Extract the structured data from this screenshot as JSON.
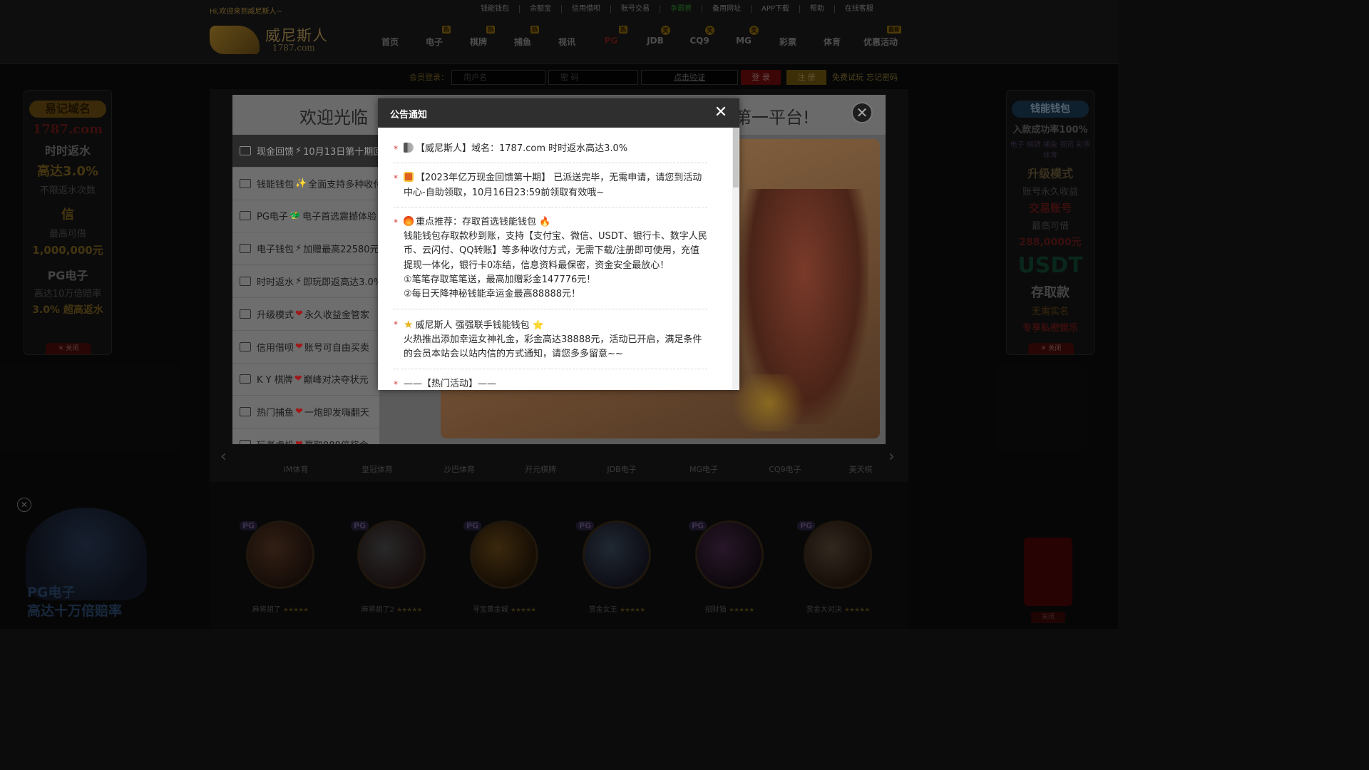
{
  "header": {
    "welcome": "Hi,欢迎来到威尼斯人~",
    "top_links": [
      "钱能钱包",
      "余额宝",
      "信用借呗",
      "账号交易",
      "争霸赛",
      "备用网址",
      "APP下载",
      "帮助",
      "在线客服"
    ],
    "top_links_highlight_index": 4,
    "logo_name": "威尼斯人",
    "logo_domain": "1787.com",
    "nav": [
      {
        "label": "首页",
        "tag": ""
      },
      {
        "label": "电子",
        "tag": "热"
      },
      {
        "label": "棋牌",
        "tag": "热"
      },
      {
        "label": "捕鱼",
        "tag": "热"
      },
      {
        "label": "视讯",
        "tag": ""
      },
      {
        "label": "PG",
        "tag": "热"
      },
      {
        "label": "JDB",
        "tag": "奖"
      },
      {
        "label": "CQ9",
        "tag": "奖"
      },
      {
        "label": "MG",
        "tag": "奖"
      },
      {
        "label": "彩票",
        "tag": ""
      },
      {
        "label": "体育",
        "tag": ""
      },
      {
        "label": "优惠活动",
        "tag": "最新"
      }
    ]
  },
  "login": {
    "label": "会员登录：",
    "username_placeholder": "用户名",
    "password_placeholder": "密 码",
    "verify_label": "点击验证",
    "login_button": "登 录",
    "register_button": "注 册",
    "free_trial": "免费试玩",
    "forgot_password": "忘记密码"
  },
  "left_ad": {
    "pill": "易记域名",
    "domain": "1787.com",
    "line1": "时时返水",
    "line2": "高达3.0%",
    "line3": "不限返水次数",
    "line4": "信",
    "line5": "最高可借",
    "line6": "1,000,000元",
    "line7": "PG电子",
    "line8": "高达10万倍赔率",
    "line9": "3.0% 超高返水",
    "close": "✕ 关闭"
  },
  "right_ad": {
    "pill": "钱能钱包",
    "line1": "入款成功率100%",
    "tags": [
      "电子",
      "棋牌",
      "捕鱼",
      "视讯",
      "彩票",
      "体育"
    ],
    "line2": "升级模式",
    "line3": "账号永久收益",
    "line4": "交易账号",
    "line5": "最高可借",
    "line6": "288,0000元",
    "line7": "USDT",
    "line8": "存取款",
    "line9": "无需实名",
    "line10": "专享私密娱乐",
    "close": "✕ 关闭"
  },
  "providers": [
    "IM体育",
    "皇冠体育",
    "沙巴体育",
    "开元棋牌",
    "JDB电子",
    "MG电子",
    "CQ9电子",
    "美天棋"
  ],
  "games": [
    {
      "name": "麻将胡了",
      "stars": "★★★★★"
    },
    {
      "name": "麻将胡了2",
      "stars": "★★★★★"
    },
    {
      "name": "寻宝黄金城",
      "stars": "★★★★★"
    },
    {
      "name": "赏金女王",
      "stars": "★★★★★"
    },
    {
      "name": "招财猫",
      "stars": "★★★★★"
    },
    {
      "name": "赏金大对决",
      "stars": "★★★★★"
    }
  ],
  "game_badge": "PG",
  "floater": {
    "text1": "PG电子",
    "text2": "高达十万倍赔率"
  },
  "red_envelope": {
    "close": "关闭"
  },
  "welcome_modal": {
    "title_left": "欢迎光临",
    "title_right": "第一平台!",
    "items": [
      {
        "label": "现金回馈",
        "accent": "⚡",
        "rest": "10月13日第十期回"
      },
      {
        "label": "钱能钱包",
        "accent": "✨",
        "rest": "全面支持多种收付"
      },
      {
        "label": "PG电子",
        "accent": "🐲",
        "rest": " 电子首选震撼体验"
      },
      {
        "label": "电子钱包",
        "accent": "⚡",
        "rest": "加赠最高22580元"
      },
      {
        "label": "时时返水",
        "accent": "⚡",
        "rest": "即玩即返高达3.0%"
      },
      {
        "label": "升级模式",
        "accent": "❤",
        "rest": "永久收益金管家"
      },
      {
        "label": "信用借呗",
        "accent": "❤",
        "rest": "账号可自由买卖"
      },
      {
        "label": "K Y 棋牌",
        "accent": "❤",
        "rest": "巅峰对决夺状元"
      },
      {
        "label": "热门捕鱼",
        "accent": "❤",
        "rest": "一炮即发嗨翻天"
      },
      {
        "label": "玩老虎机",
        "accent": "❤",
        "rest": "赢取888倍奖金"
      }
    ]
  },
  "notice": {
    "title": "公告通知",
    "close_symbol": "✕",
    "entries": [
      {
        "icon": "megaphone",
        "lines": [
          "【威尼斯人】域名：1787.com 时时返水高达3.0%"
        ]
      },
      {
        "icon": "gift",
        "lines": [
          "【2023年亿万现金回馈第十期】 已派送完毕，无需申请，请您到活动中心-自助领取，10月16日23:59前领取有效哦~"
        ]
      },
      {
        "icon": "fire",
        "lines": [
          "重点推荐：存取首选钱能钱包 🔥",
          "钱能钱包存取款秒到账，支持【支付宝、微信、USDT、银行卡、数字人民币、云闪付、QQ转账】等多种收付方式，无需下载/注册即可使用，充值提现一体化，银行卡0冻结，信息资料最保密，资金安全最放心！",
          "①笔笔存取笔笔送，最高加赠彩金147776元！",
          "②每日天降神秘钱能幸运金最高88888元！"
        ]
      },
      {
        "icon": "star",
        "lines": [
          "威尼斯人 强强联手钱能钱包 ⭐",
          "火热推出添加幸运女神礼金，彩金高达38888元，活动已开启，满足条件的会员本站会以站内信的方式通知，请您多多留意~~"
        ]
      },
      {
        "icon": "",
        "lines": [
          "——【热门活动】——"
        ]
      }
    ]
  },
  "colors": {
    "notice_header": "#2f2f2f",
    "bullet": "#d43a3a",
    "brand_gold": "#b89440"
  }
}
